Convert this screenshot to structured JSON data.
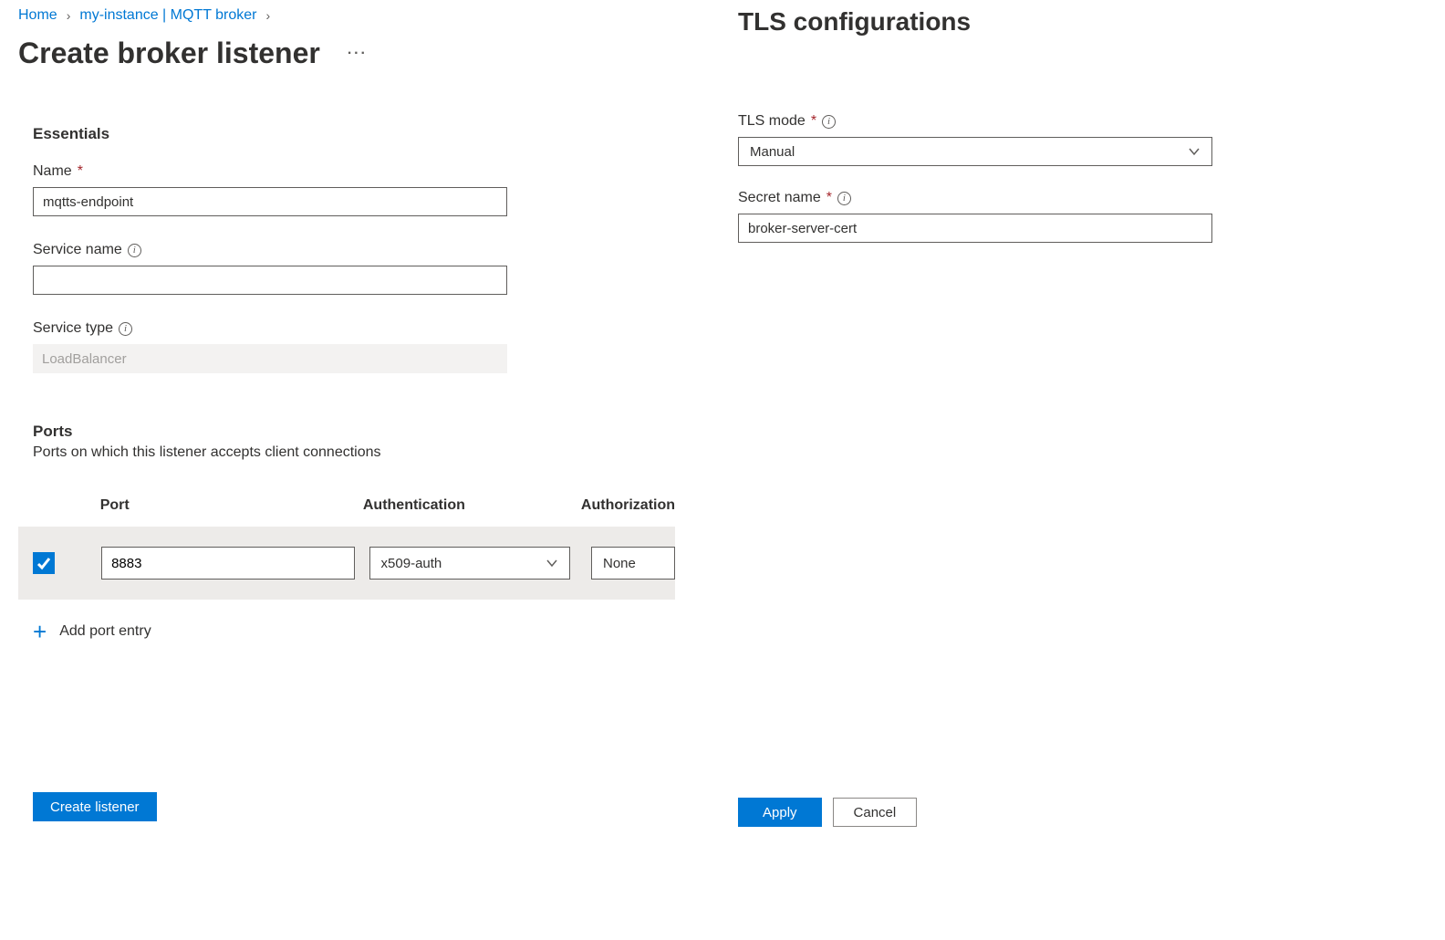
{
  "breadcrumb": {
    "home": "Home",
    "instance": "my-instance | MQTT broker"
  },
  "page_title": "Create broker listener",
  "essentials": {
    "heading": "Essentials",
    "name_label": "Name",
    "name_value": "mqtts-endpoint",
    "service_name_label": "Service name",
    "service_name_value": "",
    "service_type_label": "Service type",
    "service_type_value": "LoadBalancer"
  },
  "ports": {
    "heading": "Ports",
    "sub": "Ports on which this listener accepts client connections",
    "col_port": "Port",
    "col_auth": "Authentication",
    "col_authz": "Authorization",
    "rows": [
      {
        "checked": true,
        "port": "8883",
        "auth": "x509-auth",
        "authz": "None"
      }
    ],
    "add_label": "Add port entry"
  },
  "create_button": "Create listener",
  "panel": {
    "title": "TLS configurations",
    "tls_mode_label": "TLS mode",
    "tls_mode_value": "Manual",
    "secret_name_label": "Secret name",
    "secret_name_value": "broker-server-cert",
    "apply": "Apply",
    "cancel": "Cancel"
  }
}
